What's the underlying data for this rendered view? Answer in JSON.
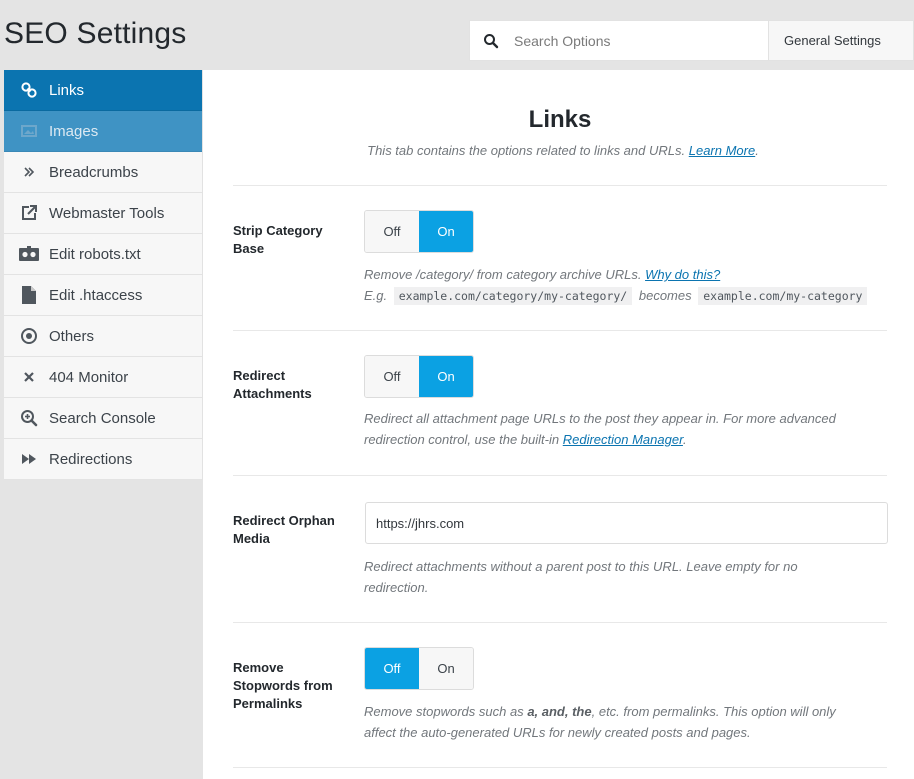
{
  "header": {
    "title": "SEO Settings",
    "search_placeholder": "Search Options",
    "settings_selector": "General Settings"
  },
  "sidebar": {
    "items": [
      {
        "label": "Links",
        "icon": "link-icon"
      },
      {
        "label": "Images",
        "icon": "images-icon"
      },
      {
        "label": "Breadcrumbs",
        "icon": "chevrons-right-icon"
      },
      {
        "label": "Webmaster Tools",
        "icon": "external-link-icon"
      },
      {
        "label": "Edit robots.txt",
        "icon": "robot-icon"
      },
      {
        "label": "Edit .htaccess",
        "icon": "file-icon"
      },
      {
        "label": "Others",
        "icon": "circle-dot-icon"
      },
      {
        "label": "404 Monitor",
        "icon": "close-icon"
      },
      {
        "label": "Search Console",
        "icon": "search-zoom-icon"
      },
      {
        "label": "Redirections",
        "icon": "fast-forward-icon"
      }
    ]
  },
  "main": {
    "heading": "Links",
    "description": "This tab contains the options related to links and URLs.",
    "learn_more": "Learn More",
    "period": "."
  },
  "fields": {
    "strip_category": {
      "label": "Strip Category Base",
      "off": "Off",
      "on": "On",
      "selected": "On",
      "help_text": "Remove /category/ from category archive URLs.",
      "help_link": "Why do this?",
      "eg": "E.g.",
      "code1": "example.com/category/my-category/",
      "becomes": "becomes",
      "code2": "example.com/my-category"
    },
    "redirect_attachments": {
      "label": "Redirect Attachments",
      "off": "Off",
      "on": "On",
      "selected": "On",
      "help_text": "Redirect all attachment page URLs to the post they appear in. For more advanced redirection control, use the built-in",
      "help_link": "Redirection Manager",
      "period": "."
    },
    "redirect_orphan": {
      "label": "Redirect Orphan Media",
      "value": "https://jhrs.com",
      "help_text": "Redirect attachments without a parent post to this URL. Leave empty for no redirection."
    },
    "remove_stopwords": {
      "label": "Remove Stopwords from Permalinks",
      "off": "Off",
      "on": "On",
      "selected": "Off",
      "help_prefix": "Remove stopwords such as",
      "help_bold": "a, and, the",
      "help_suffix": ", etc. from permalinks. This option will only affect the auto-generated URLs for newly created posts and pages."
    }
  },
  "colors": {
    "accent": "#0ba1e3",
    "sidebar_active": "#0b74b0"
  }
}
